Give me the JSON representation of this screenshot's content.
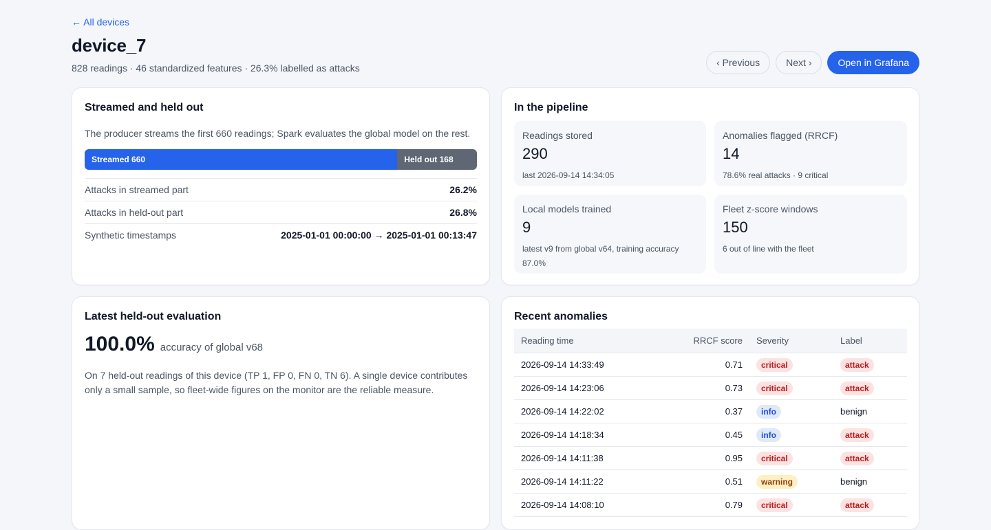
{
  "nav": {
    "back_label": "← All devices"
  },
  "header": {
    "title": "device_7",
    "subtitle": "828 readings · 46 standardized features · 26.3% labelled as attacks",
    "prev_label": "‹ Previous",
    "next_label": "Next ›",
    "grafana_label": "Open in Grafana"
  },
  "stream_card": {
    "title": "Streamed and held out",
    "description": "The producer streams the first 660 readings; Spark evaluates the global model on the rest.",
    "streamed_label": "Streamed 660",
    "held_label": "Held out 168",
    "streamed_fraction": 0.797,
    "rows": [
      {
        "label": "Attacks in streamed part",
        "value": "26.2%"
      },
      {
        "label": "Attacks in held-out part",
        "value": "26.8%"
      },
      {
        "label": "Synthetic timestamps",
        "value": "2025-01-01 00:00:00 → 2025-01-01 00:13:47"
      }
    ]
  },
  "pipeline_card": {
    "title": "In the pipeline",
    "tiles": [
      {
        "label": "Readings stored",
        "value": "290",
        "note": "last 2026-09-14 14:34:05"
      },
      {
        "label": "Anomalies flagged (RRCF)",
        "value": "14",
        "note": "78.6% real attacks · 9 critical"
      },
      {
        "label": "Local models trained",
        "value": "9",
        "note": "latest v9 from global v64, training accuracy 87.0%"
      },
      {
        "label": "Fleet z-score windows",
        "value": "150",
        "note": "6 out of line with the fleet"
      }
    ]
  },
  "eval_card": {
    "title": "Latest held-out evaluation",
    "accuracy": "100.0%",
    "accuracy_caption": "accuracy of global v68",
    "text": "On 7 held-out readings of this device (TP 1, FP 0, FN 0, TN 6). A single device contributes only a small sample, so fleet-wide figures on the monitor are the reliable measure."
  },
  "anomalies_card": {
    "title": "Recent anomalies",
    "columns": [
      "Reading time",
      "RRCF score",
      "Severity",
      "Label"
    ],
    "rows": [
      {
        "time": "2026-09-14 14:33:49",
        "score": "0.71",
        "severity": "critical",
        "label": "attack"
      },
      {
        "time": "2026-09-14 14:23:06",
        "score": "0.73",
        "severity": "critical",
        "label": "attack"
      },
      {
        "time": "2026-09-14 14:22:02",
        "score": "0.37",
        "severity": "info",
        "label": "benign"
      },
      {
        "time": "2026-09-14 14:18:34",
        "score": "0.45",
        "severity": "info",
        "label": "attack"
      },
      {
        "time": "2026-09-14 14:11:38",
        "score": "0.95",
        "severity": "critical",
        "label": "attack"
      },
      {
        "time": "2026-09-14 14:11:22",
        "score": "0.51",
        "severity": "warning",
        "label": "benign"
      },
      {
        "time": "2026-09-14 14:08:10",
        "score": "0.79",
        "severity": "critical",
        "label": "attack"
      }
    ]
  },
  "colors": {
    "accent": "#2563eb",
    "held_out": "#5f6775",
    "critical": "#b91c1c",
    "info": "#1d4ed8",
    "warning": "#92400e",
    "background": "#f4f6fa"
  }
}
